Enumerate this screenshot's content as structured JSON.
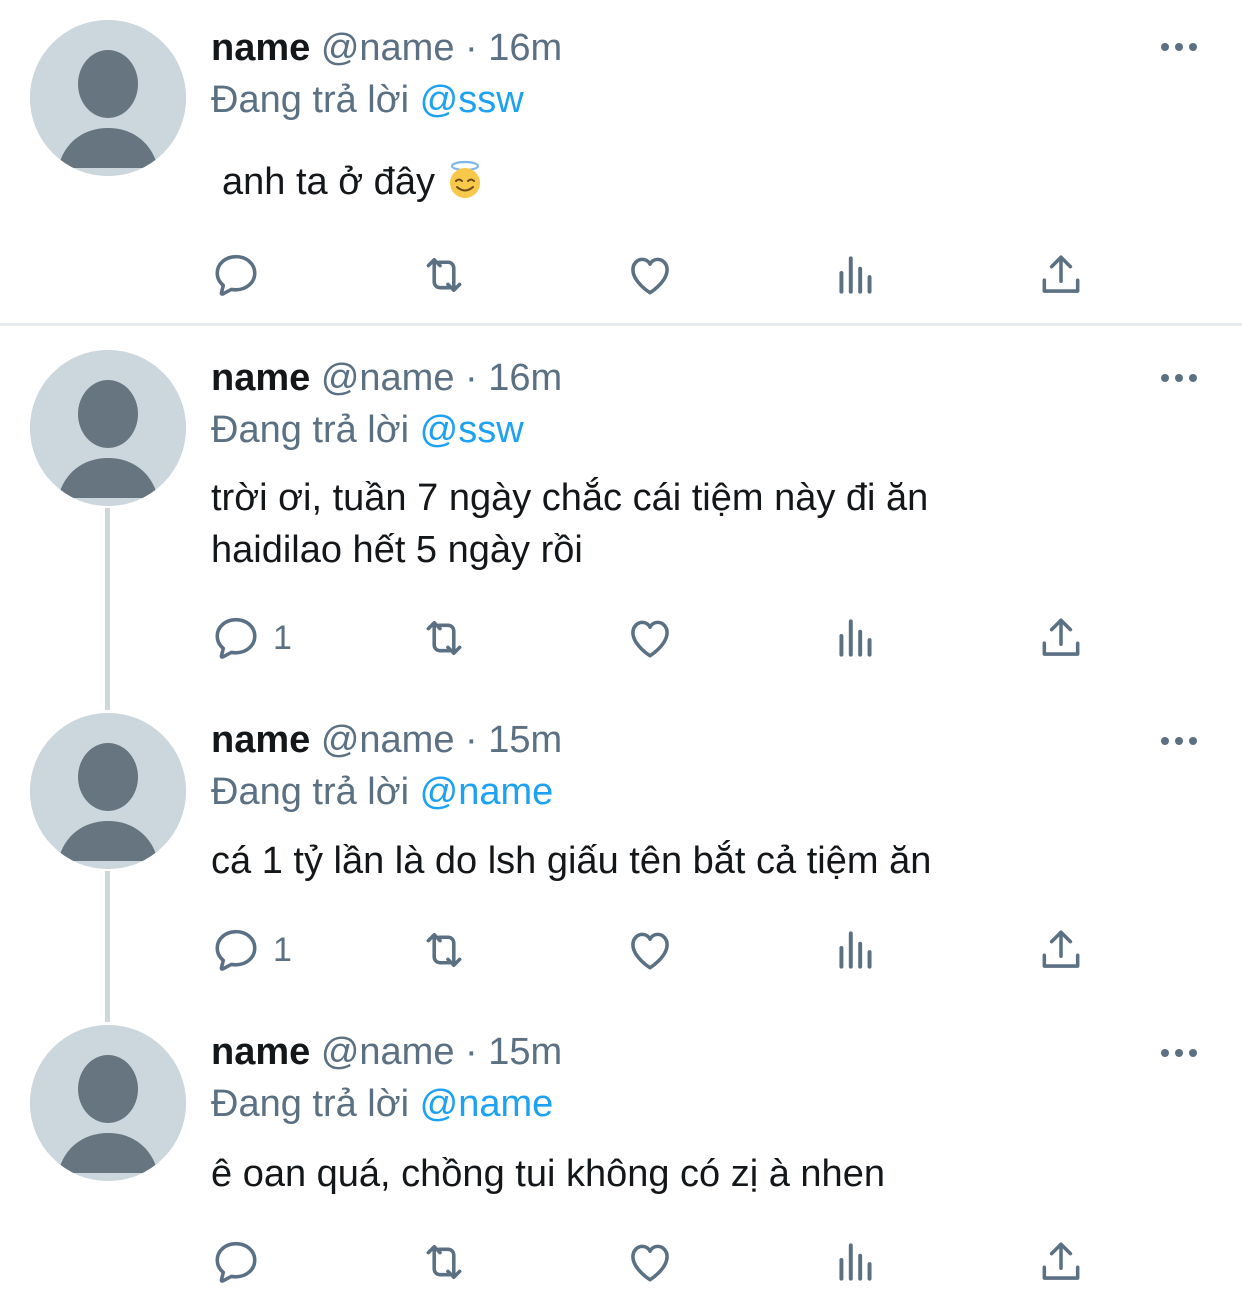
{
  "colors": {
    "accent": "#1da1f2",
    "secondary_text": "#5b7083",
    "primary_text": "#14171a",
    "avatar_bg": "#ccd6dd",
    "avatar_fg": "#66757f"
  },
  "tweets": [
    {
      "name": "name",
      "handle": "@name",
      "sep": "·",
      "time": "16m",
      "reply_prefix": "Đang trả lời",
      "reply_to": "@ssw",
      "text": "anh ta ở đây",
      "emoji": "smiling-face-with-halo",
      "reply_count": ""
    },
    {
      "name": "name",
      "handle": "@name",
      "sep": "·",
      "time": "16m",
      "reply_prefix": "Đang trả lời",
      "reply_to": "@ssw",
      "text": "trời ơi, tuần 7 ngày chắc cái tiệm này đi ăn haidilao hết 5 ngày rồi",
      "reply_count": "1"
    },
    {
      "name": "name",
      "handle": "@name",
      "sep": "·",
      "time": "15m",
      "reply_prefix": "Đang trả lời",
      "reply_to": "@name",
      "text": "cá 1 tỷ lần là do lsh giấu tên bắt cả tiệm ăn",
      "reply_count": "1"
    },
    {
      "name": "name",
      "handle": "@name",
      "sep": "·",
      "time": "15m",
      "reply_prefix": "Đang trả lời",
      "reply_to": "@name",
      "text": "ê oan quá, chồng tui không có zị à nhen",
      "reply_count": ""
    }
  ],
  "icons": {
    "reply": "reply-icon",
    "retweet": "retweet-icon",
    "like": "heart-icon",
    "analytics": "analytics-icon",
    "share": "share-icon",
    "more": "more-icon"
  }
}
